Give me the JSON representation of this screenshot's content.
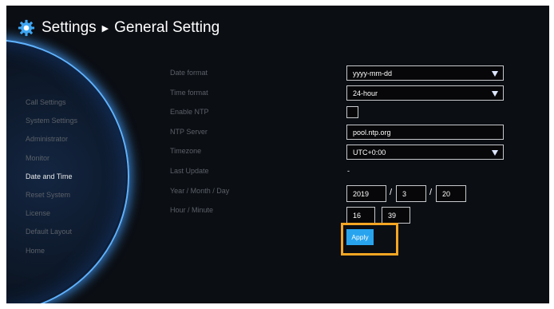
{
  "header": {
    "title": "Settings",
    "subtitle": "General Setting",
    "icon": "gear-icon"
  },
  "sidebar": {
    "items": [
      {
        "label": "Call Settings",
        "active": false
      },
      {
        "label": "System Settings",
        "active": false
      },
      {
        "label": "Administrator",
        "active": false
      },
      {
        "label": "Monitor",
        "active": false
      },
      {
        "label": "Date and Time",
        "active": true
      },
      {
        "label": "Reset System",
        "active": false
      },
      {
        "label": "License",
        "active": false
      },
      {
        "label": "Default Layout",
        "active": false
      },
      {
        "label": "Home",
        "active": false
      }
    ]
  },
  "form": {
    "date_format": {
      "label": "Date format",
      "value": "yyyy-mm-dd"
    },
    "time_format": {
      "label": "Time format",
      "value": "24-hour"
    },
    "enable_ntp": {
      "label": "Enable NTP",
      "checked": false
    },
    "ntp_server": {
      "label": "NTP Server",
      "value": "pool.ntp.org"
    },
    "timezone": {
      "label": "Timezone",
      "value": "UTC+0:00"
    },
    "last_update": {
      "label": "Last Update",
      "value": "-"
    },
    "ymd": {
      "label": "Year / Month / Day",
      "year": "2019",
      "month": "3",
      "day": "20",
      "separator": "/"
    },
    "hm": {
      "label": "Hour / Minute",
      "hour": "16",
      "minute": "39"
    },
    "apply_label": "Apply"
  },
  "colors": {
    "accent": "#28a4ef",
    "highlight": "#f5a623",
    "background": "#0b0e13"
  }
}
